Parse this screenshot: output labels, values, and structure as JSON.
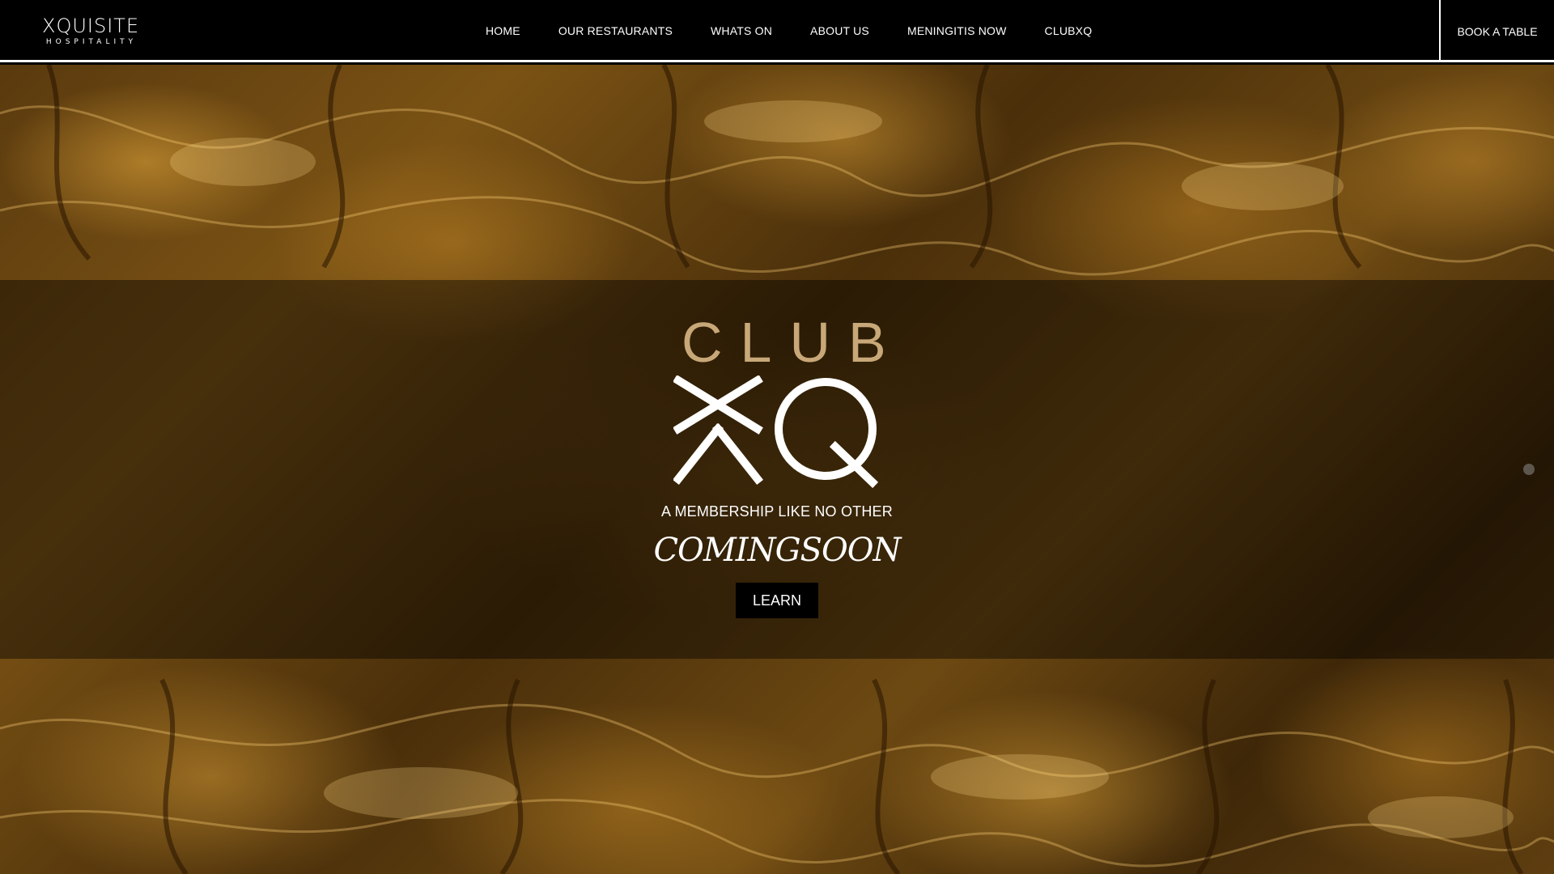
{
  "header": {
    "logo": {
      "name": "XQUISITE",
      "sub": "HOSPITALITY"
    },
    "nav": [
      {
        "label": "HOME"
      },
      {
        "label": "OUR RESTAURANTS"
      },
      {
        "label": "WHATS ON"
      },
      {
        "label": "ABOUT US"
      },
      {
        "label": "MENINGITIS NOW"
      },
      {
        "label": "CLUBXQ"
      }
    ],
    "book_label": "BOOK A TABLE"
  },
  "hero": {
    "club_word": "CLUB",
    "mark_icon": "xq-logo-mark",
    "tagline": "A MEMBERSHIP LIKE NO OTHER",
    "coming_soon": "COMINGSOON",
    "learn_label": "LEARN"
  },
  "colors": {
    "header_bg": "#000000",
    "accent_gold": "#c8a878",
    "text": "#ffffff"
  }
}
